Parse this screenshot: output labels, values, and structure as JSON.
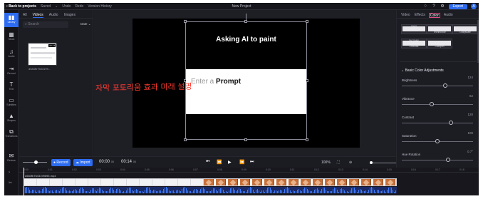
{
  "topbar": {
    "back_label": "Back to projects",
    "saved_label": "Saved",
    "undo_label": "Undo",
    "redo_label": "Redo",
    "version_label": "Version History",
    "project_title": "New Project",
    "export_label": "Export",
    "avatar_initial": "A",
    "icons": [
      "bell-icon",
      "help-icon",
      "settings-icon"
    ]
  },
  "rail": {
    "items": [
      {
        "label": "Library",
        "icon": "library-icon",
        "glyph": "▮▮"
      },
      {
        "label": "Stock",
        "icon": "stock-icon",
        "glyph": "▦"
      },
      {
        "label": "Audio",
        "icon": "audio-icon",
        "glyph": "♫"
      },
      {
        "label": "Record",
        "icon": "record-icon",
        "glyph": "⇥"
      },
      {
        "label": "Text",
        "icon": "text-icon",
        "glyph": "T"
      },
      {
        "label": "Subtitles",
        "icon": "subtitles-icon",
        "glyph": "▭"
      },
      {
        "label": "Shapes",
        "icon": "shapes-icon",
        "glyph": "▲"
      },
      {
        "label": "Transitions",
        "icon": "transitions-icon",
        "glyph": "⧉"
      },
      {
        "label": "Review",
        "icon": "review-icon",
        "glyph": "✉"
      }
    ]
  },
  "media": {
    "tabs": [
      "All",
      "Videos",
      "Audio",
      "Images"
    ],
    "active_tab": "Videos",
    "search_placeholder": "Search",
    "sort_label": "Date",
    "thumb_duration": "00:14",
    "file_name": "d583fb7543199..."
  },
  "preview": {
    "headline": "Asking AI to paint",
    "prompt_placeholder": "Enter a ",
    "prompt_bold": "Prompt",
    "annotation": "자막 포토리움 효과 미래 설명"
  },
  "controls": {
    "record_label": "Record",
    "import_label": "Import",
    "time_current": "00:00",
    "time_current_unit": "00",
    "time_total": "00:14",
    "time_total_unit": "00",
    "zoom_label": "100%",
    "playback_icons": [
      "skip-back-icon",
      "rewind-icon",
      "play-icon",
      "fast-forward-icon",
      "skip-forward-icon"
    ]
  },
  "timeline": {
    "ruler_marks": [
      "0:00",
      "0:01",
      "0:02",
      "0:03",
      "0:04",
      "0:05",
      "0:06",
      "0:07",
      "0:08",
      "0:09",
      "0:10",
      "0:11",
      "0:12",
      "0:13",
      "0:14",
      "0:15",
      "0:16",
      "0:17",
      "0:18"
    ],
    "clip_label": "d583fb7543199b95.mp4"
  },
  "right_panel": {
    "tabs": [
      "Video",
      "Effects",
      "Color",
      "Audio"
    ],
    "active_tab": "Color",
    "filters": [
      {
        "title": "Invert",
        "label": ""
      },
      {
        "title": "",
        "label": "Technicolor"
      },
      {
        "title": "",
        "label": "Grayscale"
      },
      {
        "title": "Ice Cream",
        "label": "Emboss"
      },
      {
        "title": "",
        "label": "Sharpen"
      }
    ],
    "section_title": "Basic Color Adjustments",
    "adjustments": [
      {
        "label": "Brightness",
        "value": "124",
        "level": 0.62
      },
      {
        "label": "Vibrance",
        "value": "62",
        "level": 0.42
      },
      {
        "label": "Contrast",
        "value": "120",
        "level": 0.7
      },
      {
        "label": "Saturation",
        "value": "100",
        "level": 0.5
      },
      {
        "label": "Hue Rotation",
        "value": "0.7°",
        "level": 0.66
      }
    ]
  }
}
